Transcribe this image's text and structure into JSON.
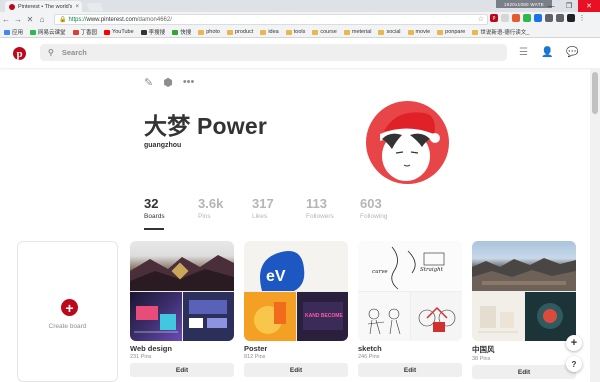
{
  "browser": {
    "tab_title": "Pinterest • The world's",
    "stamp": "1920x1080 WATE",
    "url_secure": "https://",
    "url_host": "www.pinterest.com",
    "url_path": "/damon4662/",
    "window_controls": [
      "—",
      "❐",
      "✕"
    ],
    "nav_icons": [
      "←",
      "→",
      "✕",
      "⌂"
    ],
    "bookmarks": [
      {
        "label": "应用",
        "color": "#4285f4"
      },
      {
        "label": "网易云课堂",
        "color": "#2db84d"
      },
      {
        "label": "丁香园",
        "color": "#e03c31"
      },
      {
        "label": "YouTube",
        "color": "#ff0000"
      },
      {
        "label": "李搜搜",
        "color": "#333333"
      },
      {
        "label": "快搜",
        "color": "#31a531"
      },
      {
        "label": "photo",
        "color": "#e8b94a"
      },
      {
        "label": "product",
        "color": "#e8b94a"
      },
      {
        "label": "idea",
        "color": "#e8b94a"
      },
      {
        "label": "tools",
        "color": "#e8b94a"
      },
      {
        "label": "course",
        "color": "#e8b94a"
      },
      {
        "label": "meterial",
        "color": "#e8b94a"
      },
      {
        "label": "social",
        "color": "#e8b94a"
      },
      {
        "label": "movie",
        "color": "#e8b94a"
      },
      {
        "label": "ponpare",
        "color": "#e8b94a"
      },
      {
        "label": "世说新语-德行读文_",
        "color": "#e8b94a"
      }
    ]
  },
  "header": {
    "logo": "p",
    "search_placeholder": "Search",
    "icons": [
      "menu-icon",
      "user-icon",
      "messages-icon"
    ]
  },
  "profile": {
    "actions": [
      "✎",
      "⬢",
      "•••"
    ],
    "name": "大梦 Power",
    "location": "guangzhou",
    "stats": [
      {
        "num": "32",
        "label": "Boards"
      },
      {
        "num": "3.6k",
        "label": "Pins"
      },
      {
        "num": "317",
        "label": "Likes"
      },
      {
        "num": "113",
        "label": "Followers"
      },
      {
        "num": "603",
        "label": "Following"
      }
    ]
  },
  "create_board": {
    "label": "Create board",
    "plus": "+"
  },
  "boards": [
    {
      "title": "Web design",
      "pins": "231 Pins",
      "edit": "Edit"
    },
    {
      "title": "Poster",
      "pins": "812 Pins",
      "edit": "Edit"
    },
    {
      "title": "sketch",
      "pins": "246 Pins",
      "edit": "Edit"
    },
    {
      "title": "中国风",
      "pins": "38 Pins",
      "edit": "Edit"
    }
  ],
  "cover_text": {
    "poster_a": "eV",
    "poster_b": "KAND BECOME",
    "sketch_a": "curve",
    "sketch_b": "Straight"
  },
  "fabs": {
    "plus": "+",
    "help": "?"
  },
  "colors": {
    "brand": "#bd081c",
    "avatar_bg": "#e84548"
  }
}
